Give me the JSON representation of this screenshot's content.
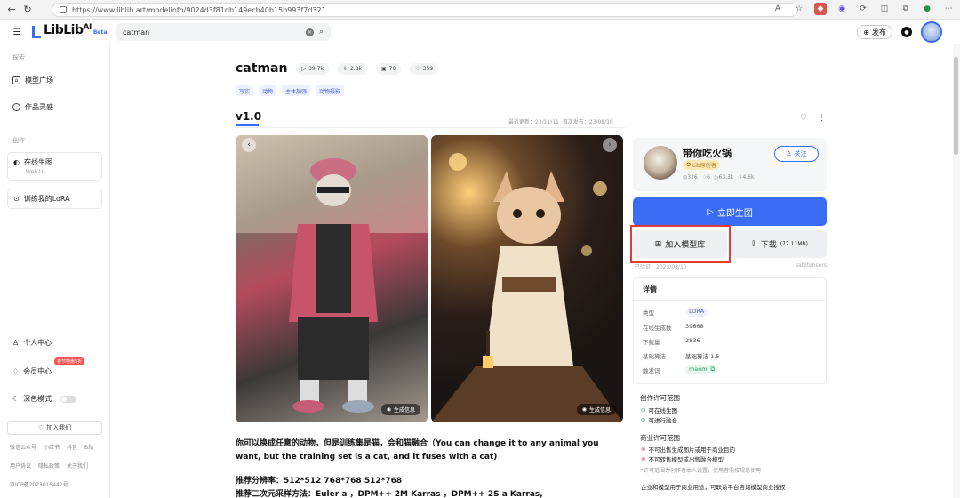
{
  "browser": {
    "url": "https://www.liblib.art/modelinfo/9024d3f81db149ecb40b15b993f7d321"
  },
  "header": {
    "logo_text": "LibLib",
    "logo_ai": "AI",
    "logo_beta": "Beta",
    "search_value": "catman",
    "publish_label": "发布"
  },
  "sidebar": {
    "section_explore": "探索",
    "items_explore": [
      "模型广场",
      "作品灵感"
    ],
    "section_create": "创作",
    "online_gen": {
      "title": "在线生图",
      "sub": "Web UI"
    },
    "train_lora": "训练我的LoRA",
    "personal": "个人中心",
    "vip": "会员中心",
    "vip_badge": "春节特惠5折",
    "dark_mode": "深色模式",
    "join_us": "加入我们",
    "footer_row1": [
      "微信公众号",
      "小红书",
      "抖音",
      "B站"
    ],
    "footer_row2": [
      "用户协议",
      "隐私政策",
      "关于我们"
    ],
    "icp": "京ICP备2023015442号"
  },
  "model": {
    "title": "catman",
    "stats": {
      "runs": "39.7k",
      "downloads": "2.8k",
      "images": "70",
      "likes": "359"
    },
    "tags": [
      "写实",
      "动物",
      "主体加强",
      "动物摄影"
    ],
    "version": "v1.0",
    "updated": "最近更新：23/11/11",
    "first_published": "首次发布：23/08/10",
    "gen_info_label": "生成信息",
    "description": "你可以换成任意的动物，但是训练集是猫，会和猫融合（You can change it to any animal you want, but the training set is a cat, and it fuses with a cat)",
    "rec_resolution": "推荐分辨率：512*512 768*768 512*768",
    "rec_sampler": "推荐二次元采样方法：Euler a ，DPM++ 2M Karras ，DPM++ 2S a Karras,"
  },
  "author": {
    "name": "带你吃火锅",
    "badge": "Lib原创者",
    "stats": [
      "326",
      "6",
      "63.3k",
      "4.6k"
    ],
    "follow_label": "关注"
  },
  "actions": {
    "generate": "立即生图",
    "add_library": "加入模型库",
    "download": "下载",
    "download_size": "(72.11MB)",
    "verified": "已验证：2023/08/10",
    "format": "safetensors"
  },
  "details": {
    "heading": "详情",
    "rows": [
      {
        "k": "类型",
        "v": "LORA"
      },
      {
        "k": "在线生成数",
        "v": "39668"
      },
      {
        "k": "下载量",
        "v": "2836"
      },
      {
        "k": "基础算法",
        "v": "基础算法 1.5"
      },
      {
        "k": "触发词",
        "v": "maomi"
      }
    ]
  },
  "license": {
    "creation_h": "创作许可范围",
    "creation_items": [
      "可在线生图",
      "可进行融合"
    ],
    "commercial_h": "商业许可范围",
    "commercial_items": [
      "不可出售生成图片或用于商业目的",
      "不可转售模型或出售融合模型"
    ],
    "note": "*许可范围为创作者本人设置，使用者需按规范使用",
    "enterprise": "企业和模型用于商业用途，可联系平台咨询模型商业授权"
  }
}
